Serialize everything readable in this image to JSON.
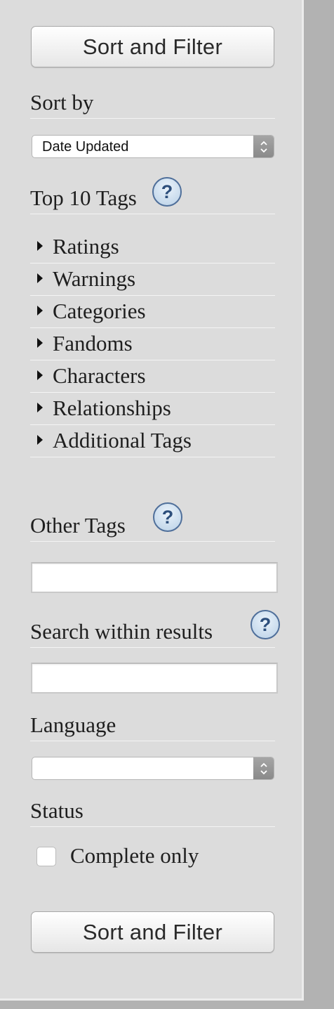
{
  "buttons": {
    "top_label": "Sort and Filter",
    "bottom_label": "Sort and Filter"
  },
  "sort": {
    "heading": "Sort by",
    "selected": "Date Updated"
  },
  "top_tags": {
    "heading": "Top 10 Tags",
    "help": "?",
    "items": [
      "Ratings",
      "Warnings",
      "Categories",
      "Fandoms",
      "Characters",
      "Relationships",
      "Additional Tags"
    ]
  },
  "other_tags": {
    "heading": "Other Tags",
    "help": "?",
    "value": ""
  },
  "search_within": {
    "heading": "Search within results",
    "help": "?",
    "value": ""
  },
  "language": {
    "heading": "Language",
    "selected": ""
  },
  "status": {
    "heading": "Status",
    "checkbox_label": "Complete only",
    "checked": false
  }
}
